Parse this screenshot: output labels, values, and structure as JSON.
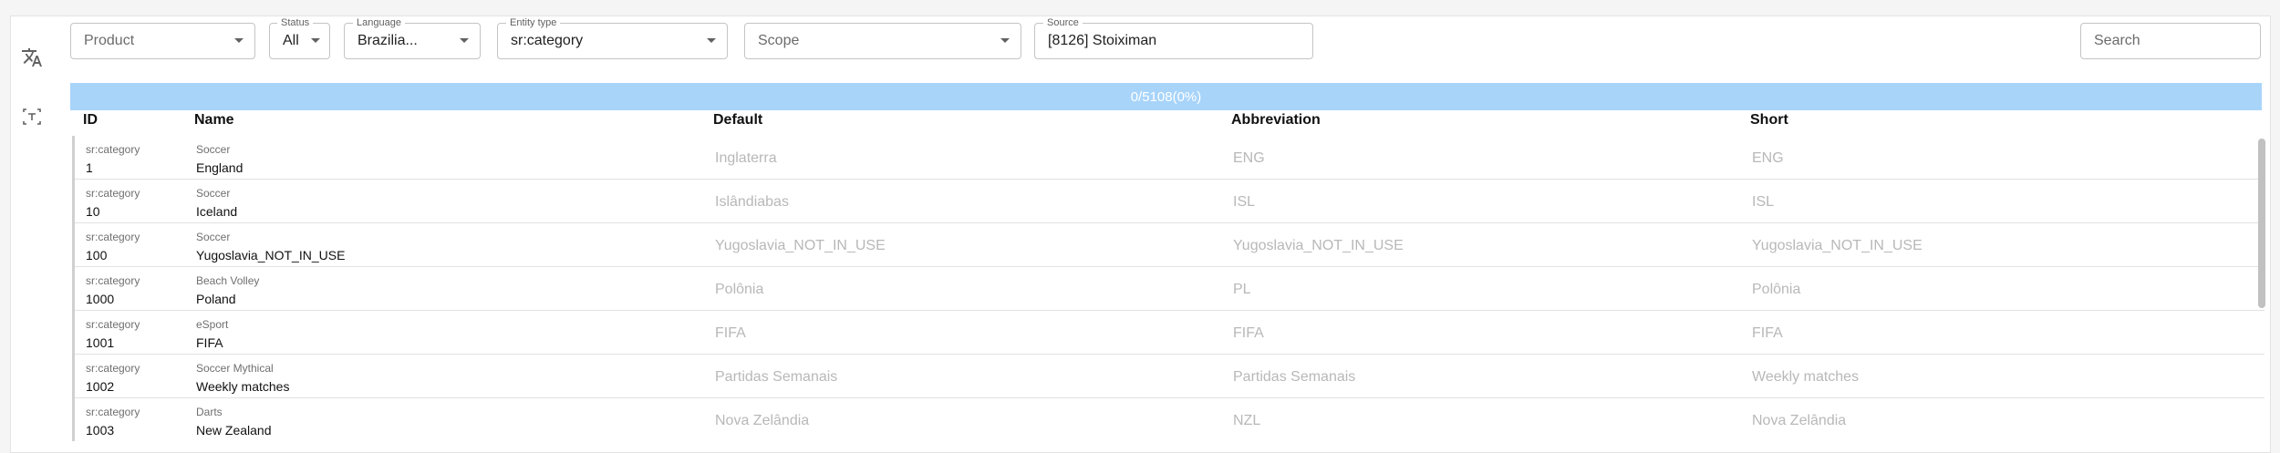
{
  "filters": {
    "product": {
      "placeholder": "Product"
    },
    "status": {
      "label": "Status",
      "value": "All"
    },
    "language": {
      "label": "Language",
      "value": "Brazilia..."
    },
    "entity_type": {
      "label": "Entity type",
      "value": "sr:category"
    },
    "scope": {
      "placeholder": "Scope"
    },
    "source": {
      "label": "Source",
      "value": "[8126] Stoiximan"
    },
    "search": {
      "placeholder": "Search"
    }
  },
  "sidebar": {
    "translate_icon": "translate-icon",
    "text_select_icon": "text-select-icon"
  },
  "progress": {
    "text": "0/5108(0%)",
    "fraction": 0
  },
  "table": {
    "columns": [
      "ID",
      "Name",
      "Default",
      "Abbreviation",
      "Short"
    ],
    "rows": [
      {
        "type": "sr:category",
        "id": "1",
        "sport": "Soccer",
        "name": "England",
        "default": "Inglaterra",
        "abbr": "ENG",
        "short": "ENG"
      },
      {
        "type": "sr:category",
        "id": "10",
        "sport": "Soccer",
        "name": "Iceland",
        "default": "Islândiabas",
        "abbr": "ISL",
        "short": "ISL"
      },
      {
        "type": "sr:category",
        "id": "100",
        "sport": "Soccer",
        "name": "Yugoslavia_NOT_IN_USE",
        "default": "Yugoslavia_NOT_IN_USE",
        "abbr": "Yugoslavia_NOT_IN_USE",
        "short": "Yugoslavia_NOT_IN_USE"
      },
      {
        "type": "sr:category",
        "id": "1000",
        "sport": "Beach Volley",
        "name": "Poland",
        "default": "Polônia",
        "abbr": "PL",
        "short": "Polônia"
      },
      {
        "type": "sr:category",
        "id": "1001",
        "sport": "eSport",
        "name": "FIFA",
        "default": "FIFA",
        "abbr": "FIFA",
        "short": "FIFA"
      },
      {
        "type": "sr:category",
        "id": "1002",
        "sport": "Soccer Mythical",
        "name": "Weekly matches",
        "default": "Partidas Semanais",
        "abbr": "Partidas Semanais",
        "short": "Weekly matches"
      },
      {
        "type": "sr:category",
        "id": "1003",
        "sport": "Darts",
        "name": "New Zealand",
        "default": "Nova Zelândia",
        "abbr": "NZL",
        "short": "Nova Zelândia"
      }
    ]
  }
}
